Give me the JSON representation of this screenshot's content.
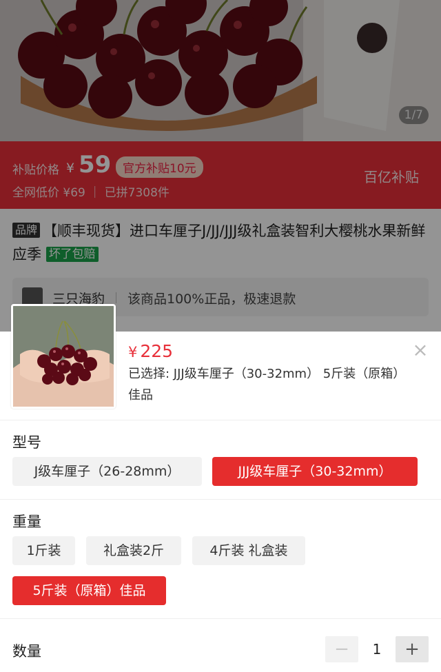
{
  "product": {
    "image_counter": "1/7",
    "subsidy_label": "补贴价格",
    "subsidy_yen": "¥",
    "subsidy_price": "59",
    "subsidy_badge": "官方补贴10元",
    "sub_info": "全网低价 ¥69 ｜ 已拼7308件",
    "promo_right": "百亿补贴",
    "brand_tag": "品牌",
    "title": "【顺丰现货】进口车厘子J/JJ/JJJ级礼盒装智利大樱桃水果新鲜应季",
    "broken_tag": "坏了包赔",
    "store_name": "三只海豹",
    "store_note": "该商品100%正品，极速退款"
  },
  "sheet": {
    "price_yen": "¥",
    "price": "225",
    "selected_text": "已选择: JJJ级车厘子（30-32mm） 5斤装（原箱）佳品",
    "close_icon": "close-icon",
    "model_label": "型号",
    "model_options": [
      "J级车厘子（26-28mm）",
      "JJJ级车厘子（30-32mm）"
    ],
    "weight_label": "重量",
    "weight_options": [
      "1斤装",
      "礼盒装2斤",
      "4斤装 礼盒装",
      "5斤装（原箱）佳品"
    ],
    "qty_label": "数量",
    "qty_minus": "−",
    "qty_value": "1",
    "qty_plus": "+"
  },
  "colors": {
    "accent_red": "#e52d2d",
    "price_red": "#e8303a",
    "chip_bg": "#f2f2f2"
  }
}
